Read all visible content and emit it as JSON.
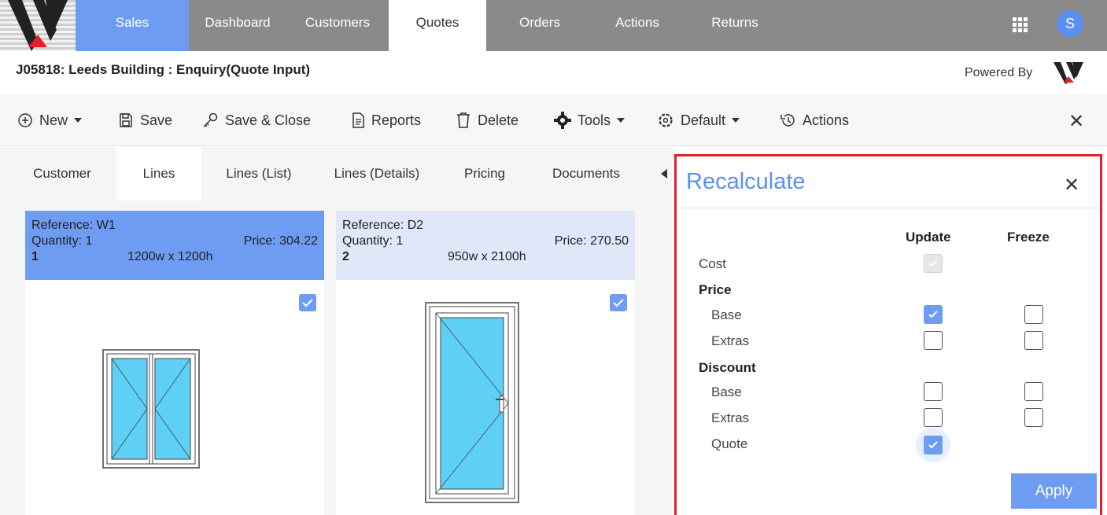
{
  "nav": {
    "tabs": [
      "Sales",
      "Dashboard",
      "Customers",
      "Quotes",
      "Orders",
      "Actions",
      "Returns"
    ],
    "active": "Quotes",
    "avatar_initial": "S"
  },
  "header": {
    "title": "J05818: Leeds Building : Enquiry(Quote Input)",
    "powered_by": "Powered By"
  },
  "toolbar": {
    "new": "New",
    "save": "Save",
    "save_close": "Save & Close",
    "reports": "Reports",
    "delete": "Delete",
    "tools": "Tools",
    "default": "Default",
    "actions": "Actions"
  },
  "subtabs": [
    "Customer",
    "Lines",
    "Lines (List)",
    "Lines (Details)",
    "Pricing",
    "Documents"
  ],
  "lines": [
    {
      "reference": "Reference: W1",
      "quantity": "Quantity: 1",
      "price": "Price: 304.22",
      "number": "1",
      "size": "1200w x 1200h",
      "selected": true
    },
    {
      "reference": "Reference: D2",
      "quantity": "Quantity: 1",
      "price": "Price: 270.50",
      "number": "2",
      "size": "950w x 2100h",
      "selected": false
    }
  ],
  "recalculate": {
    "title": "Recalculate",
    "col_update": "Update",
    "col_freeze": "Freeze",
    "cost": "Cost",
    "price": "Price",
    "price_base": "Base",
    "price_extras": "Extras",
    "discount": "Discount",
    "discount_base": "Base",
    "discount_extras": "Extras",
    "discount_quote": "Quote",
    "apply": "Apply"
  },
  "colors": {
    "accent": "#6d9cf2",
    "highlight_border": "#e0202a",
    "nav_bg": "#8a8a8a"
  }
}
